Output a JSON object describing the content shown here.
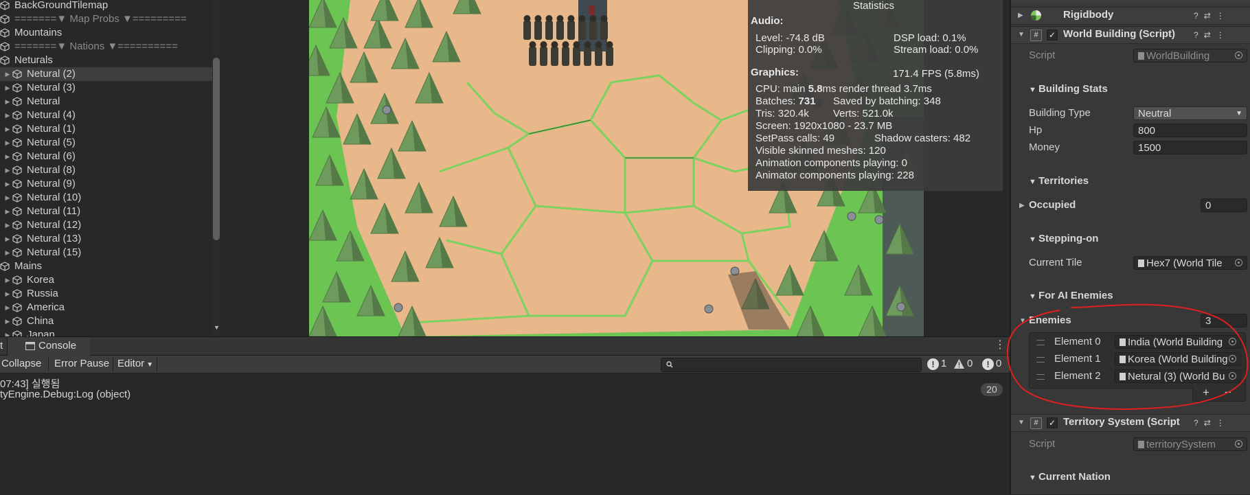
{
  "hierarchy": {
    "items": [
      {
        "label": "BackGroundTilemap",
        "kind": "object"
      },
      {
        "label": "=======▼ Map Probs ▼=========",
        "kind": "separator"
      },
      {
        "label": "Mountains",
        "kind": "object"
      },
      {
        "label": "=======▼ Nations ▼==========",
        "kind": "separator"
      },
      {
        "label": "Neturals",
        "kind": "object"
      },
      {
        "label": "Netural (2)",
        "kind": "prefab",
        "selected": true
      },
      {
        "label": "Netural (3)",
        "kind": "prefab"
      },
      {
        "label": "Netural",
        "kind": "prefab"
      },
      {
        "label": "Netural (4)",
        "kind": "prefab"
      },
      {
        "label": "Netural (1)",
        "kind": "prefab"
      },
      {
        "label": "Netural (5)",
        "kind": "prefab"
      },
      {
        "label": "Netural (6)",
        "kind": "prefab"
      },
      {
        "label": "Netural (8)",
        "kind": "prefab"
      },
      {
        "label": "Netural (9)",
        "kind": "prefab"
      },
      {
        "label": "Netural (10)",
        "kind": "prefab"
      },
      {
        "label": "Netural (11)",
        "kind": "prefab"
      },
      {
        "label": "Netural (12)",
        "kind": "prefab"
      },
      {
        "label": "Netural (13)",
        "kind": "prefab"
      },
      {
        "label": "Netural (15)",
        "kind": "prefab"
      },
      {
        "label": "Mains",
        "kind": "object"
      },
      {
        "label": "Korea",
        "kind": "prefab"
      },
      {
        "label": "Russia",
        "kind": "prefab"
      },
      {
        "label": "America",
        "kind": "prefab"
      },
      {
        "label": "China",
        "kind": "prefab"
      },
      {
        "label": "Japan",
        "kind": "prefab"
      }
    ]
  },
  "stats": {
    "title": "Statistics",
    "audio_header": "Audio:",
    "level": "Level: -74.8 dB",
    "clipping": "Clipping: 0.0%",
    "dsp": "DSP load: 0.1%",
    "stream": "Stream load: 0.0%",
    "graphics_header": "Graphics:",
    "fps": "171.4 FPS (5.8ms)",
    "cpu_prefix": "CPU: main ",
    "cpu_main": "5.8",
    "cpu_suffix": "ms  render thread 3.7ms",
    "batches_prefix": "Batches: ",
    "batches": "731",
    "saved": "Saved by batching: 348",
    "tris": "Tris: 320.4k",
    "verts": "Verts: 521.0k",
    "screen": "Screen: 1920x1080 - 23.7 MB",
    "setpass": "SetPass calls: 49",
    "shadow": "Shadow casters: 482",
    "skinned": "Visible skinned meshes: 120",
    "anim": "Animation components playing: 0",
    "animator": "Animator components playing: 228"
  },
  "console": {
    "tab_prev": "t",
    "tab_label": "Console",
    "collapse": "Collapse",
    "error_pause": "Error Pause",
    "editor": "Editor",
    "error_count": "1",
    "warning_count": "0",
    "info_count": "0",
    "log_line1": "07:43] 실행됨",
    "log_line2": "tyEngine.Debug:Log (object)",
    "log_count": "20"
  },
  "inspector": {
    "rigidbody_title": "Rigidbody",
    "world_building_title": "World Building (Script)",
    "script_label": "Script",
    "script_value": "WorldBuilding",
    "building_stats_header": "Building Stats",
    "building_type_label": "Building Type",
    "building_type_value": "Neutral",
    "hp_label": "Hp",
    "hp_value": "800",
    "money_label": "Money",
    "money_value": "1500",
    "territories_header": "Territories",
    "occupied_label": "Occupied",
    "occupied_value": "0",
    "stepping_header": "Stepping-on",
    "current_tile_label": "Current Tile",
    "current_tile_value": "Hex7 (World Tile",
    "ai_header": "For AI Enemies",
    "enemies_label": "Enemies",
    "enemies_count": "3",
    "elements": [
      {
        "label": "Element 0",
        "value": "India (World Building"
      },
      {
        "label": "Element 1",
        "value": "Korea (World Building"
      },
      {
        "label": "Element 2",
        "value": "Netural (3) (World Bu"
      }
    ],
    "plus": "+",
    "minus": "−",
    "territory_title": "Territory System (Script",
    "territory_script_value": "territorySystem",
    "current_nation_header": "Current Nation"
  },
  "colors": {
    "hex_tile": "#e8b88a",
    "grass": "#6cc452",
    "tree": "#6f9a5d",
    "annotation": "#e02020"
  }
}
